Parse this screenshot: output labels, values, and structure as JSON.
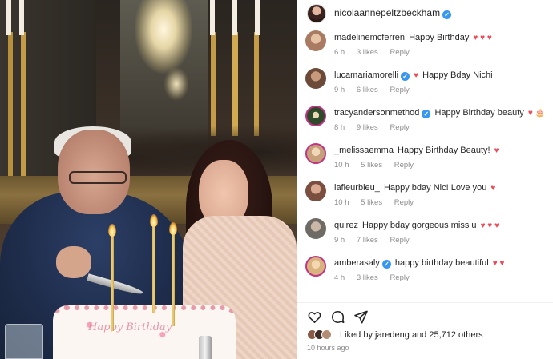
{
  "post": {
    "author": "nicolaannepeltzbeckham",
    "author_verified": true
  },
  "media": {
    "cake_text": "Happy Birthday"
  },
  "comments": [
    {
      "user": "madelinemcferren",
      "verified": false,
      "text": "Happy Birthday",
      "emoji": "♥ ♥ ♥",
      "time": "6 h",
      "likes": "3 likes",
      "reply": "Reply",
      "avatar_color": "#a97b62"
    },
    {
      "user": "lucamariamorelli",
      "verified": true,
      "text": "Happy Bday Nichi",
      "emoji_prefix": "♥",
      "time": "9 h",
      "likes": "6 likes",
      "reply": "Reply",
      "avatar_color": "#6b4a3a"
    },
    {
      "user": "tracyandersonmethod",
      "verified": true,
      "text": "Happy Birthday beauty",
      "emoji": "♥ 🎂",
      "time": "8 h",
      "likes": "9 likes",
      "reply": "Reply",
      "avatar_color": "#2f4a2b"
    },
    {
      "user": "_melissaemma",
      "verified": false,
      "text": "Happy Birthday Beauty!",
      "emoji": "♥",
      "time": "10 h",
      "likes": "5 likes",
      "reply": "Reply",
      "avatar_color": "#c6a07a"
    },
    {
      "user": "lafleurbleu_",
      "verified": false,
      "text": "Happy bday Nic! Love you",
      "emoji": "♥",
      "time": "10 h",
      "likes": "5 likes",
      "reply": "Reply",
      "avatar_color": "#7b4f3f"
    },
    {
      "user": "quirez",
      "verified": false,
      "text": "Happy bday gorgeous miss u",
      "emoji": "♥ ♥ ♥",
      "time": "9 h",
      "likes": "7 likes",
      "reply": "Reply",
      "avatar_color": "#6e6a66"
    },
    {
      "user": "amberasaly",
      "verified": true,
      "text": "happy birthday beautiful",
      "emoji": "♥ ♥",
      "time": "4 h",
      "likes": "3 likes",
      "reply": "Reply",
      "avatar_color": "#d9b37d"
    }
  ],
  "footer": {
    "liked_prefix": "Liked by",
    "liked_user": "jaredeng",
    "liked_suffix": "and 25,712 others",
    "time_ago": "10 hours ago"
  },
  "icons": {
    "like": "heart-icon",
    "comment": "comment-icon",
    "share": "share-icon"
  }
}
